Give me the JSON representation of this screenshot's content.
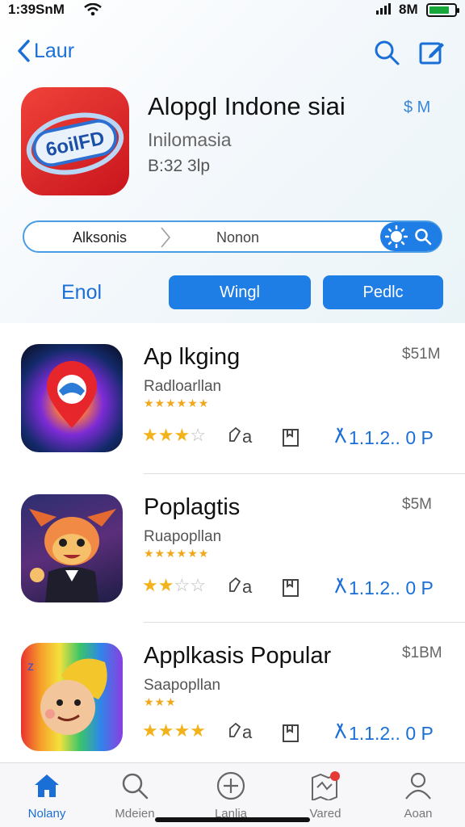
{
  "status_bar": {
    "time": "1:39SnM",
    "right_text": "8M"
  },
  "nav": {
    "back_label": "Laur"
  },
  "app": {
    "icon_text": "6oilFD",
    "title": "Alopgl Indone siai",
    "subtitle": "Inilomasia",
    "size": "B:32 3lp",
    "header_icons": "$ M"
  },
  "search": {
    "left_segment": "Alksonis",
    "right_segment": "Nonon"
  },
  "filters": {
    "text_label": "Enol",
    "button_1": "Wingl",
    "button_2": "Pedlc"
  },
  "items": [
    {
      "title": "Ap lkging",
      "subtitle": "Radloarllan",
      "rating_stars": "★★★★★★",
      "price": "$51M",
      "stars_full": 3,
      "stars_total": 4,
      "a_label": "a",
      "version": "1.1.2.. 0 P"
    },
    {
      "title": "Poplagtis",
      "subtitle": "Ruapopllan",
      "rating_stars": "★★★★★★",
      "price": "$5M",
      "stars_full": 2,
      "stars_total": 4,
      "a_label": "a",
      "version": "1.1.2.. 0 P"
    },
    {
      "title": "Applkasis Popular",
      "subtitle": "Saapopllan",
      "rating_stars": "★★★",
      "price": "$1BM",
      "stars_full": 4,
      "stars_total": 4,
      "a_label": "a",
      "version": "1.1.2.. 0 P"
    }
  ],
  "tabs": [
    {
      "label": "Nolany",
      "icon": "home-icon",
      "active": true
    },
    {
      "label": "Mdeien",
      "icon": "search-icon",
      "active": false
    },
    {
      "label": "Lanlia",
      "icon": "plus-circle-icon",
      "active": false
    },
    {
      "label": "Vared",
      "icon": "map-icon",
      "active": false
    },
    {
      "label": "Aoan",
      "icon": "person-icon",
      "active": false
    }
  ],
  "colors": {
    "accent": "#1f7de6",
    "link": "#1a6fd6",
    "star": "#f4b21a",
    "badge": "#e53935"
  }
}
